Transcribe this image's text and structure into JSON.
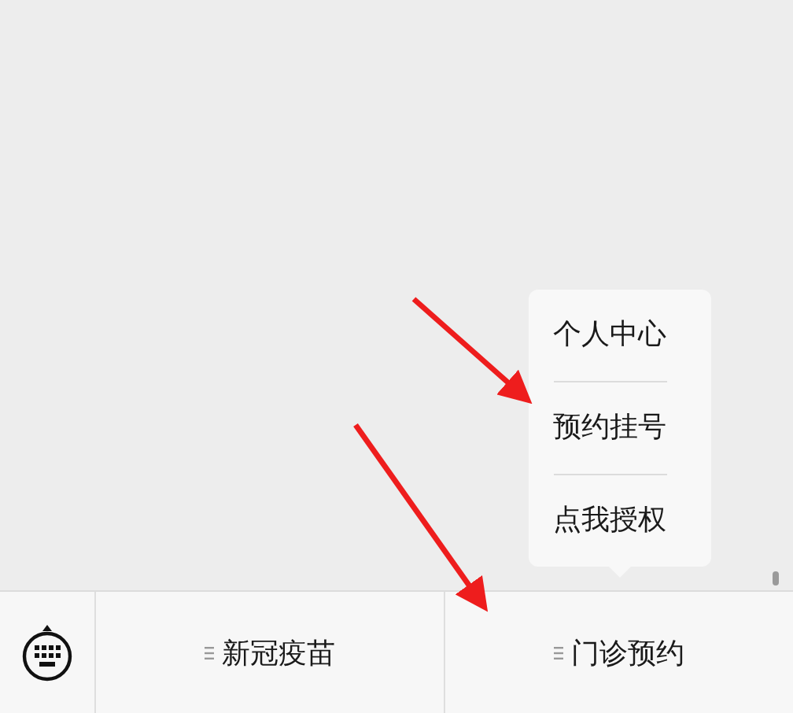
{
  "menu_bar": {
    "items": [
      {
        "label": "新冠疫苗"
      },
      {
        "label": "门诊预约",
        "submenu": [
          {
            "label": "个人中心"
          },
          {
            "label": "预约挂号"
          },
          {
            "label": "点我授权"
          }
        ]
      }
    ]
  }
}
